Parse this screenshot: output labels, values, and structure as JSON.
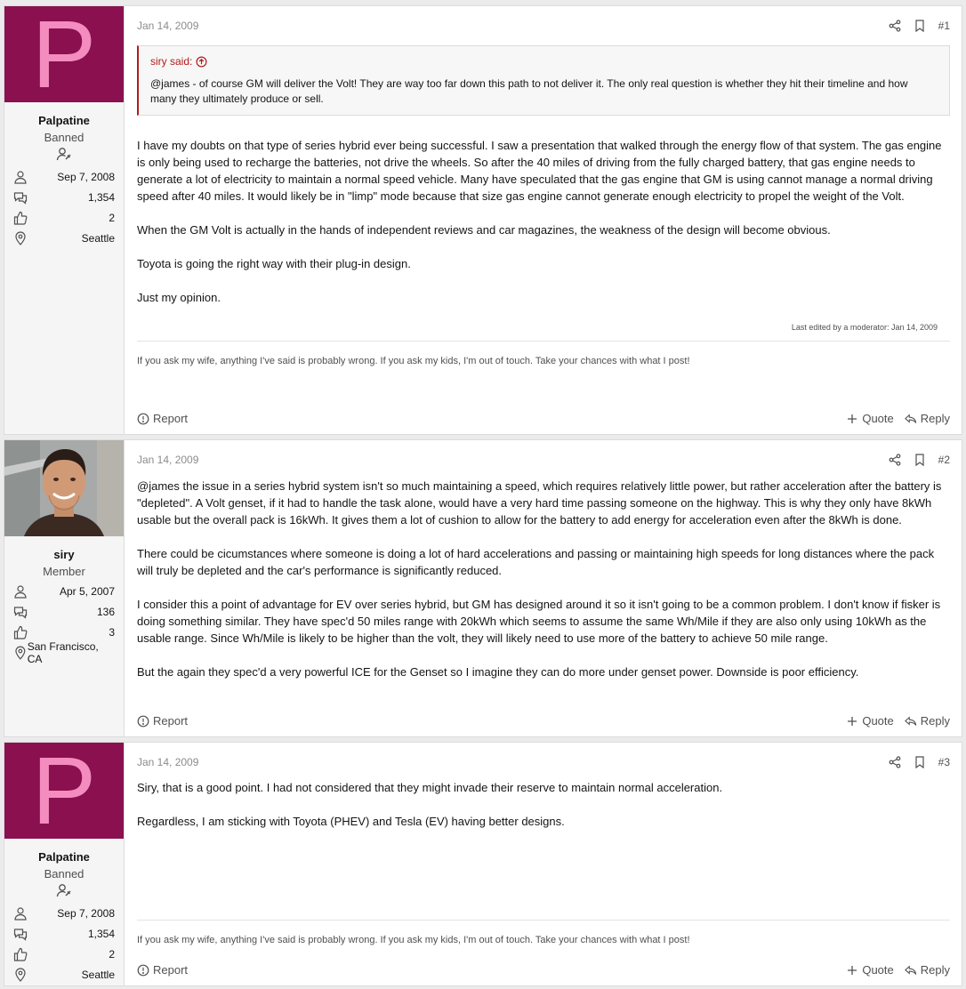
{
  "posts": [
    {
      "avatar_letter": "P",
      "username": "Palpatine",
      "user_title": "Banned",
      "joined": "Sep 7, 2008",
      "messages": "1,354",
      "reactions": "2",
      "location": "Seattle",
      "date": "Jan 14, 2009",
      "number": "#1",
      "quote": {
        "by": "siry said:",
        "text": "@james - of course GM will deliver the Volt! They are way too far down this path to not deliver it. The only real question is whether they hit their timeline and how many they ultimately produce or sell."
      },
      "paragraphs": [
        "I have my doubts on that type of series hybrid ever being successful. I saw a presentation that walked through the energy flow of that system. The gas engine is only being used to recharge the batteries, not drive the wheels. So after the 40 miles of driving from the fully charged battery, that gas engine needs to generate a lot of electricity to maintain a normal speed vehicle. Many have speculated that the gas engine that GM is using cannot manage a normal driving speed after 40 miles. It would likely be in \"limp\" mode because that size gas engine cannot generate enough electricity to propel the weight of the Volt.",
        "When the GM Volt is actually in the hands of independent reviews and car magazines, the weakness of the design will become obvious.",
        "Toyota is going the right way with their plug-in design.",
        "Just my opinion."
      ],
      "edited": "Last edited by a moderator: Jan 14, 2009",
      "signature": "If you ask my wife, anything I've said is probably wrong. If you ask my kids, I'm out of touch. Take your chances with what I post!"
    },
    {
      "username": "siry",
      "user_title": "Member",
      "joined": "Apr 5, 2007",
      "messages": "136",
      "reactions": "3",
      "location": "San Francisco, CA",
      "date": "Jan 14, 2009",
      "number": "#2",
      "paragraphs": [
        "@james the issue in a series hybrid system isn't so much maintaining a speed, which requires relatively little power, but rather acceleration after the battery is \"depleted\". A Volt genset, if it had to handle the task alone, would have a very hard time passing someone on the highway. This is why they only have 8kWh usable but the overall pack is 16kWh. It gives them a lot of cushion to allow for the battery to add energy for acceleration even after the 8kWh is done.",
        "There could be cicumstances where someone is doing a lot of hard accelerations and passing or maintaining high speeds for long distances where the pack will truly be depleted and the car's performance is significantly reduced.",
        "I consider this a point of advantage for EV over series hybrid, but GM has designed around it so it isn't going to be a common problem. I don't know if fisker is doing something similar. They have spec'd 50 miles range with 20kWh which seems to assume the same Wh/Mile if they are also only using 10kWh as the usable range. Since Wh/Mile is likely to be higher than the volt, they will likely need to use more of the battery to achieve 50 mile range.",
        "But the again they spec'd a very powerful ICE for the Genset so I imagine they can do more under genset power. Downside is poor efficiency."
      ]
    },
    {
      "avatar_letter": "P",
      "username": "Palpatine",
      "user_title": "Banned",
      "joined": "Sep 7, 2008",
      "messages": "1,354",
      "reactions": "2",
      "location": "Seattle",
      "date": "Jan 14, 2009",
      "number": "#3",
      "paragraphs": [
        "Siry, that is a good point. I had not considered that they might invade their reserve to maintain normal acceleration.",
        "Regardless, I am sticking with Toyota (PHEV) and Tesla (EV) having better designs."
      ],
      "signature": "If you ask my wife, anything I've said is probably wrong. If you ask my kids, I'm out of touch. Take your chances with what I post!"
    }
  ],
  "actions": {
    "report": "Report",
    "quote": "Quote",
    "reply": "Reply"
  },
  "colors": {
    "avatar_bg": "#8a1050",
    "avatar_letter": "#f48cbf",
    "quote_accent": "#b31b1b"
  }
}
